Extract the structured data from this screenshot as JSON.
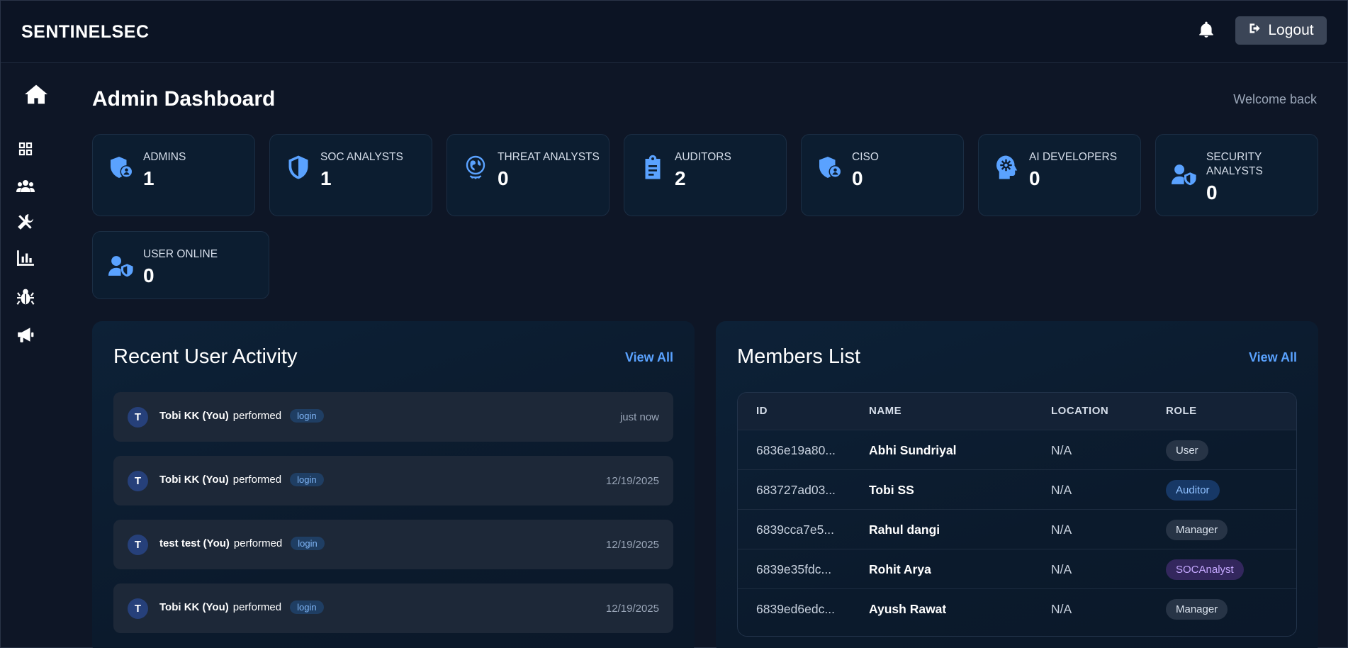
{
  "brand": "SENTINELSEC",
  "header": {
    "logout_label": "Logout"
  },
  "page": {
    "title": "Admin Dashboard",
    "welcome": "Welcome back"
  },
  "sidebar": {
    "items": [
      {
        "name": "home",
        "icon": "home-icon"
      },
      {
        "name": "dashboard",
        "icon": "grid-icon"
      },
      {
        "name": "users",
        "icon": "users-icon"
      },
      {
        "name": "tools",
        "icon": "tools-icon"
      },
      {
        "name": "reports",
        "icon": "chart-bar-icon"
      },
      {
        "name": "threats",
        "icon": "bug-icon"
      },
      {
        "name": "announcements",
        "icon": "megaphone-icon"
      }
    ]
  },
  "stats": [
    {
      "label": "ADMINS",
      "value": "1",
      "icon": "user-shield-icon"
    },
    {
      "label": "SOC ANALYSTS",
      "value": "1",
      "icon": "shield-icon"
    },
    {
      "label": "THREAT ANALYSTS",
      "value": "0",
      "icon": "threat-globe-icon"
    },
    {
      "label": "AUDITORS",
      "value": "2",
      "icon": "clipboard-icon"
    },
    {
      "label": "CISO",
      "value": "0",
      "icon": "user-shield-icon"
    },
    {
      "label": "AI DEVELOPERS",
      "value": "0",
      "icon": "ai-head-icon"
    },
    {
      "label": "SECURITY ANALYSTS",
      "value": "0",
      "icon": "user-shield-person-icon"
    },
    {
      "label": "USER ONLINE",
      "value": "0",
      "icon": "user-shield-person-icon"
    }
  ],
  "activity": {
    "title": "Recent User Activity",
    "view_all": "View All",
    "items": [
      {
        "initial": "T",
        "user": "Tobi KK (You)",
        "verb": "performed",
        "action": "login",
        "time": "just now"
      },
      {
        "initial": "T",
        "user": "Tobi KK (You)",
        "verb": "performed",
        "action": "login",
        "time": "12/19/2025"
      },
      {
        "initial": "T",
        "user": "test test (You)",
        "verb": "performed",
        "action": "login",
        "time": "12/19/2025"
      },
      {
        "initial": "T",
        "user": "Tobi KK (You)",
        "verb": "performed",
        "action": "login",
        "time": "12/19/2025"
      }
    ]
  },
  "members": {
    "title": "Members List",
    "view_all": "View All",
    "columns": [
      "ID",
      "NAME",
      "LOCATION",
      "ROLE"
    ],
    "rows": [
      {
        "id": "6836e19a80...",
        "name": "Abhi Sundriyal",
        "location": "N/A",
        "role": "User"
      },
      {
        "id": "683727ad03...",
        "name": "Tobi SS",
        "location": "N/A",
        "role": "Auditor"
      },
      {
        "id": "6839cca7e5...",
        "name": "Rahul dangi",
        "location": "N/A",
        "role": "Manager"
      },
      {
        "id": "6839e35fdc...",
        "name": "Rohit Arya",
        "location": "N/A",
        "role": "SOCAnalyst"
      },
      {
        "id": "6839ed6edc...",
        "name": "Ayush Rawat",
        "location": "N/A",
        "role": "Manager"
      }
    ]
  },
  "colors": {
    "background": "#0e1626",
    "accent": "#5aa2ff",
    "icon": "#5aa2ff"
  }
}
